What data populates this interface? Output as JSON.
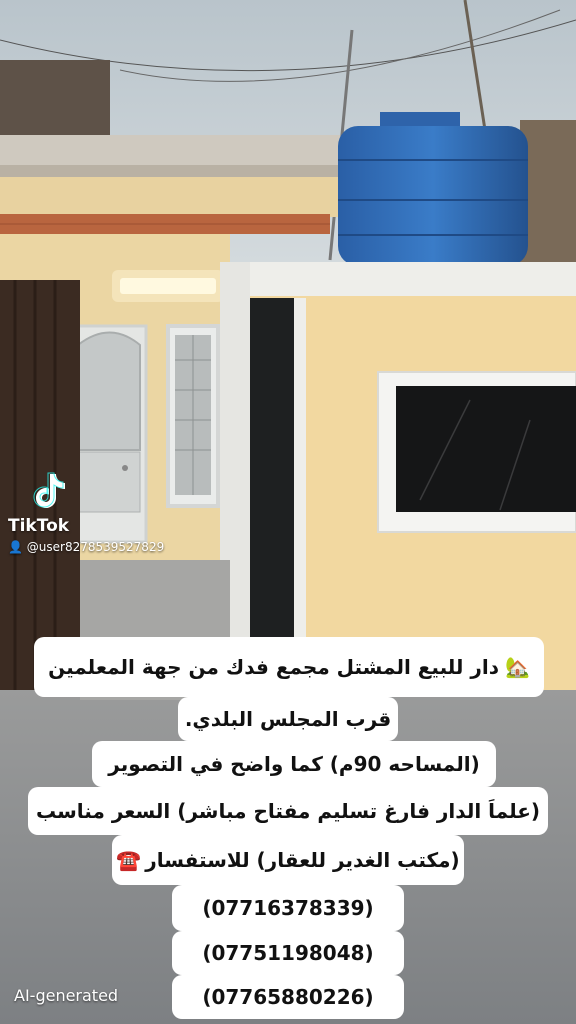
{
  "watermark": {
    "brand": "TikTok",
    "user": "@user8278539527829",
    "logo_icon": "tiktok-note-icon",
    "user_icon": "person-icon"
  },
  "caption": {
    "line1_icon": "house-with-garden-emoji",
    "line1": "دار للبيع المشتل مجمع فدك من جهة المعلمين",
    "line2": "قرب المجلس البلدي.",
    "line3": "(المساحه 90م) كما واضح في التصوير",
    "line4": "(علماَ الدار فارغ تسليم مفتاح مباشر) السعر مناسب",
    "line5": "(مكتب الغدير للعقار) للاستفسار",
    "line5_icon": "telephone-emoji",
    "phones": [
      "(07716378339)",
      "(07751198048)",
      "(07765880226)"
    ]
  },
  "ai_label": "AI-generated",
  "colors": {
    "sky": "#c7d0d6",
    "wall_yellow": "#f1d9a7",
    "water_tank": "#2f6fb8",
    "door_dark": "#3a2a22",
    "ground": "#8b8d8f",
    "caption_bg": "#ffffff"
  }
}
